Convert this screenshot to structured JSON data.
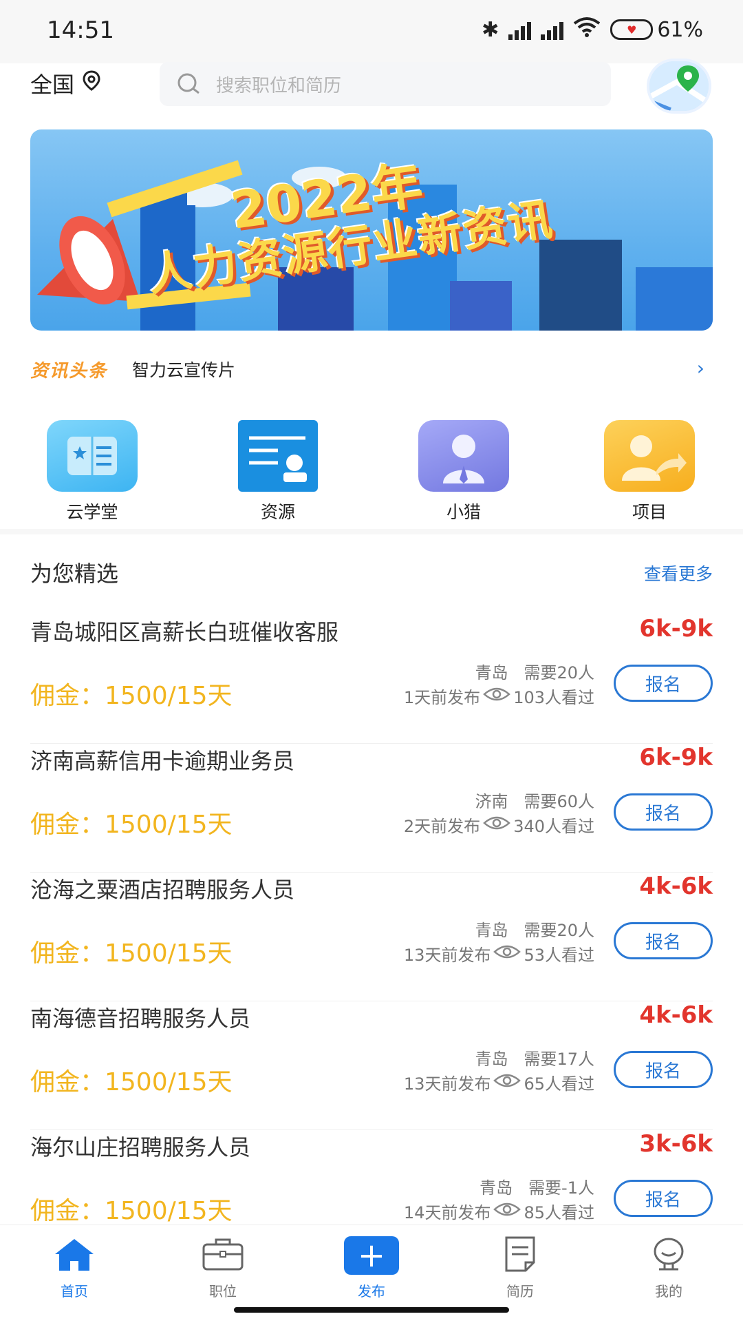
{
  "status_bar": {
    "time": "14:51",
    "battery": "61%"
  },
  "header": {
    "region": "全国",
    "search_placeholder": "搜索职位和简历"
  },
  "banner": {
    "line1": "2022年",
    "line2": "人力资源行业新资讯"
  },
  "news": {
    "tag": "资讯头条",
    "text": "智力云宣传片",
    "arrow": "›"
  },
  "quick_links": [
    {
      "label": "云学堂",
      "icon": "book-icon",
      "color": "#5cc2f5"
    },
    {
      "label": "资源",
      "icon": "resource-card-icon",
      "color": "#1a8fe0"
    },
    {
      "label": "小猎",
      "icon": "person-icon",
      "color": "#8c90ee"
    },
    {
      "label": "项目",
      "icon": "project-share-icon",
      "color": "#fbbf2b"
    }
  ],
  "section": {
    "title": "为您精选",
    "more": "查看更多"
  },
  "jobs": [
    {
      "title": "青岛城阳区高薪长白班催收客服",
      "salary": "6k-9k",
      "commission": "佣金：1500/15天",
      "city": "青岛",
      "need": "需要20人",
      "posted": "1天前发布",
      "views": "103人看过",
      "button": "报名"
    },
    {
      "title": "济南高薪信用卡逾期业务员",
      "salary": "6k-9k",
      "commission": "佣金：1500/15天",
      "city": "济南",
      "need": "需要60人",
      "posted": "2天前发布",
      "views": "340人看过",
      "button": "报名"
    },
    {
      "title": "沧海之粟酒店招聘服务人员",
      "salary": "4k-6k",
      "commission": "佣金：1500/15天",
      "city": "青岛",
      "need": "需要20人",
      "posted": "13天前发布",
      "views": "53人看过",
      "button": "报名"
    },
    {
      "title": "南海德音招聘服务人员",
      "salary": "4k-6k",
      "commission": "佣金：1500/15天",
      "city": "青岛",
      "need": "需要17人",
      "posted": "13天前发布",
      "views": "65人看过",
      "button": "报名"
    },
    {
      "title": "海尔山庄招聘服务人员",
      "salary": "3k-6k",
      "commission": "佣金：1500/15天",
      "city": "青岛",
      "need": "需要-1人",
      "posted": "14天前发布",
      "views": "85人看过",
      "button": "报名"
    }
  ],
  "tabs": [
    {
      "label": "首页",
      "icon": "home-icon",
      "active": true
    },
    {
      "label": "职位",
      "icon": "briefcase-icon",
      "active": false
    },
    {
      "label": "发布",
      "icon": "plus-icon",
      "active": true
    },
    {
      "label": "简历",
      "icon": "document-icon",
      "active": false
    },
    {
      "label": "我的",
      "icon": "profile-icon",
      "active": false
    }
  ]
}
